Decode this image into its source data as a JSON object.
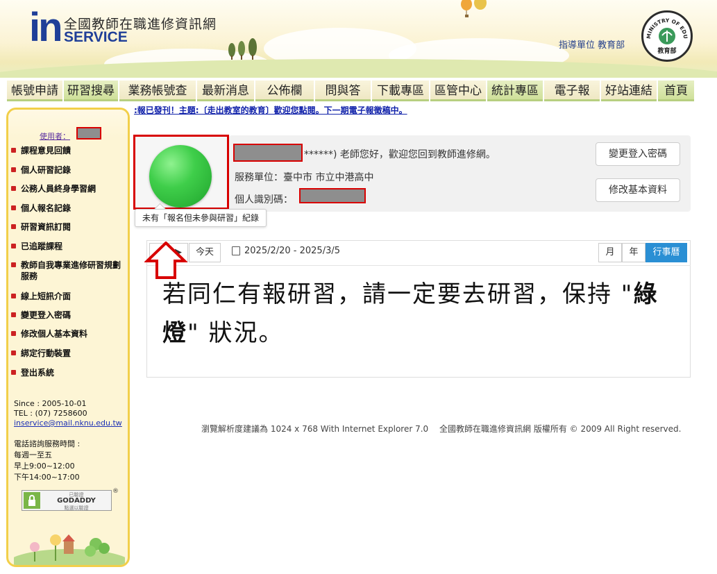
{
  "header": {
    "logo_mark": "in",
    "title": "全國教師在職進修資訊網",
    "subtitle": "SERVICE",
    "supervisor": "指導單位 教育部",
    "seal_text": "MINISTRY OF EDUCATION",
    "seal_cn": "教育部"
  },
  "nav": [
    {
      "label": "帳號申請",
      "w": 80,
      "style": "light"
    },
    {
      "label": "研習搜尋",
      "w": 78,
      "style": "green"
    },
    {
      "label": "業務帳號查",
      "w": 110,
      "style": "light"
    },
    {
      "label": "最新消息",
      "w": 82,
      "style": "light"
    },
    {
      "label": "公佈欄",
      "w": 84,
      "style": "light"
    },
    {
      "label": "問與答",
      "w": 80,
      "style": "light"
    },
    {
      "label": "下載專區",
      "w": 82,
      "style": "light"
    },
    {
      "label": "區管中心",
      "w": 80,
      "style": "light"
    },
    {
      "label": "統計專區",
      "w": 80,
      "style": "green"
    },
    {
      "label": "電子報",
      "w": 80,
      "style": "light"
    },
    {
      "label": "好站連結",
      "w": 80,
      "style": "light"
    },
    {
      "label": "首頁",
      "w": 52,
      "style": "green"
    }
  ],
  "marquee": ":報已發刊！主題:〔走出教室的教育〕歡迎您點閱。下一期電子報徵稿中。",
  "sidebar": {
    "user_label": "使用者：",
    "items": [
      "課程意見回饋",
      "個人研習記錄",
      "公務人員終身學習網",
      "個人報名記錄",
      "研習資訊訂閱",
      "已追蹤課程",
      "教師自我專業進修研習規劃服務",
      "線上短訊介面",
      "變更登入密碼",
      "修改個人基本資料",
      "綁定行動裝置",
      "登出系統"
    ],
    "since": "Since : 2005-10-01",
    "tel": "TEL : (07) 7258600",
    "email": "inservice@mail.nknu.edu.tw",
    "hours_title": "電話諮詢服務時間 :",
    "hours_days": "每週一至五",
    "hours_am": "早上9:00~12:00",
    "hours_pm": "下午14:00~17:00",
    "badge_small": "已驗證",
    "badge_name": "GODADDY",
    "badge_sub": "點選以驗證",
    "badge_mark": "®"
  },
  "user": {
    "greeting": "******) 老師您好，歡迎您回到教師進修網。",
    "unit": "服務單位：臺中市 市立中港高中",
    "id_label": "個人識別碼：",
    "tooltip": "未有「報名但未參與研習」紀錄",
    "btn_password": "變更登入密碼",
    "btn_profile": "修改基本資料"
  },
  "calendar": {
    "prev": "◀",
    "next": "▶",
    "today": "今天",
    "range": "2025/2/20 - 2025/3/5",
    "view_month": "月",
    "view_year": "年",
    "view_agenda": "行事曆"
  },
  "note": {
    "part1": "若同仁有報研習，請一定要去研習，保持 \"",
    "bold": "綠燈",
    "part2": "\" 狀況。"
  },
  "footer": "瀏覽解析度建議為 1024 x 768 With Internet Explorer 7.0　 全國教師在職進修資訊網 版權所有 © 2009 All Right reserved.",
  "colors": {
    "brand_blue": "#1f3f98",
    "highlight_red": "#d80000",
    "status_green": "#3fce4a",
    "agenda_blue": "#2a8fd4"
  }
}
